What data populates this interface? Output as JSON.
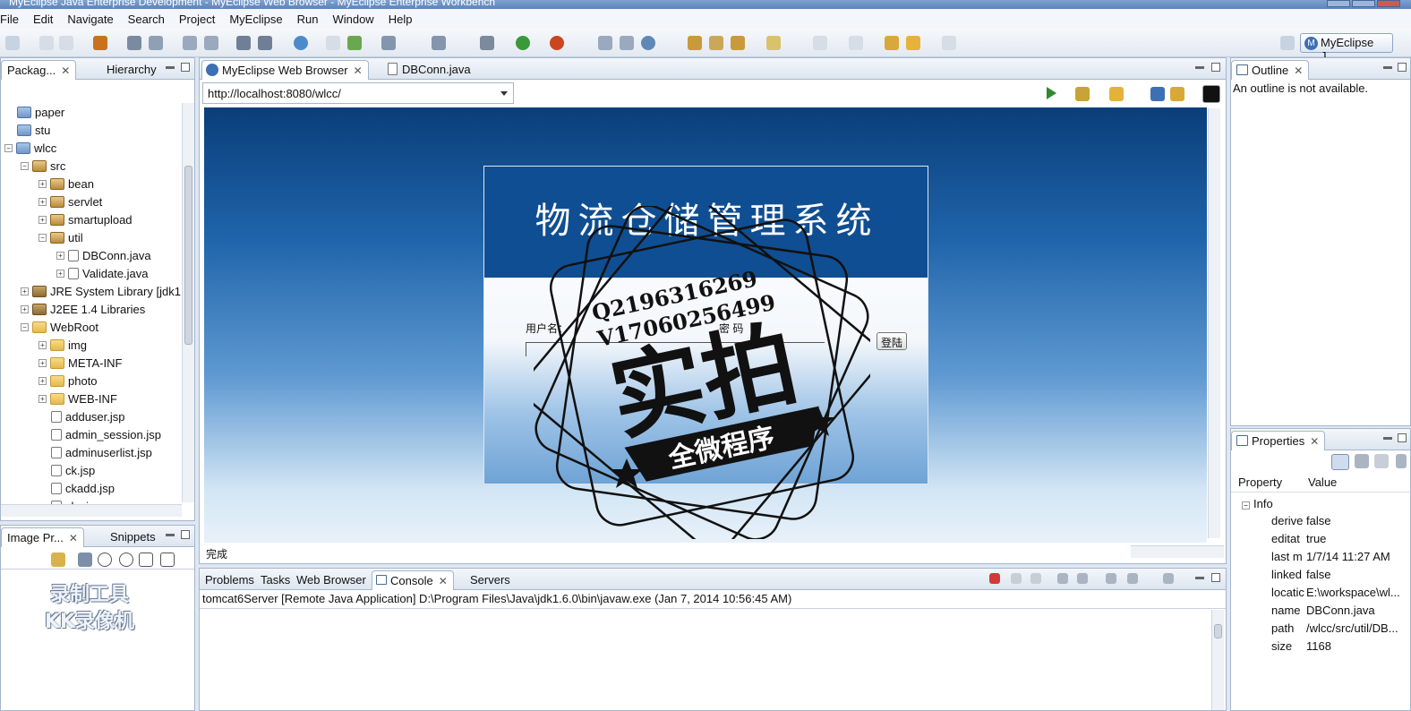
{
  "window": {
    "title": "MyEclipse Java Enterprise Development - MyEclipse Web Browser - MyEclipse Enterprise Workbench"
  },
  "menu": [
    "File",
    "Edit",
    "Navigate",
    "Search",
    "Project",
    "MyEclipse",
    "Run",
    "Window",
    "Help"
  ],
  "perspective": {
    "label": "MyEclipse J..."
  },
  "package_explorer": {
    "tabs": [
      "Packag...",
      "Hierarchy"
    ],
    "items": [
      {
        "label": "paper"
      },
      {
        "label": "stu"
      },
      {
        "label": "wlcc"
      },
      {
        "label": "src"
      },
      {
        "label": "bean"
      },
      {
        "label": "servlet"
      },
      {
        "label": "smartupload"
      },
      {
        "label": "util"
      },
      {
        "label": "DBConn.java"
      },
      {
        "label": "Validate.java"
      },
      {
        "label": "JRE System Library [jdk1"
      },
      {
        "label": "J2EE 1.4 Libraries"
      },
      {
        "label": "WebRoot"
      },
      {
        "label": "img"
      },
      {
        "label": "META-INF"
      },
      {
        "label": "photo"
      },
      {
        "label": "WEB-INF"
      },
      {
        "label": "adduser.jsp"
      },
      {
        "label": "admin_session.jsp"
      },
      {
        "label": "adminuserlist.jsp"
      },
      {
        "label": "ck.jsp"
      },
      {
        "label": "ckadd.jsp"
      },
      {
        "label": "cks.jsp"
      }
    ]
  },
  "image_panel": {
    "tabs": [
      "Image Pr...",
      "Snippets"
    ],
    "watermark_lines": [
      "录制工具",
      "KK录像机"
    ]
  },
  "editor": {
    "tabs": [
      "MyEclipse Web Browser",
      "DBConn.java"
    ],
    "url": "http://localhost:8080/wlcc/",
    "status": "完成"
  },
  "page": {
    "title": "物流仓储管理系统",
    "username_label": "用户名：",
    "password_label": "密  码",
    "login_button": "登陆"
  },
  "overlay_stamp": {
    "contact_line1": "Q2196316269",
    "contact_line2": "V17060256499",
    "big_text": "实拍",
    "ribbon_text": "全微程序"
  },
  "console": {
    "tabs": [
      "Problems",
      "Tasks",
      "Web Browser",
      "Console",
      "Servers"
    ],
    "line": "tomcat6Server [Remote Java Application] D:\\Program Files\\Java\\jdk1.6.0\\bin\\javaw.exe (Jan 7, 2014 10:56:45 AM)"
  },
  "outline": {
    "tab": "Outline",
    "message": "An outline is not available."
  },
  "properties": {
    "tab": "Properties",
    "headers": [
      "Property",
      "Value"
    ],
    "group": "Info",
    "rows": [
      {
        "key": "derive",
        "value": "false"
      },
      {
        "key": "editat",
        "value": "true"
      },
      {
        "key": "last m",
        "value": "1/7/14 11:27 AM"
      },
      {
        "key": "linked",
        "value": "false"
      },
      {
        "key": "locatic",
        "value": "E:\\workspace\\wl..."
      },
      {
        "key": "name",
        "value": "DBConn.java"
      },
      {
        "key": "path",
        "value": "/wlcc/src/util/DB..."
      },
      {
        "key": "size",
        "value": "1168"
      }
    ]
  },
  "colors": {
    "accent": "#0f4e92",
    "panel_border": "#a6b6cc"
  }
}
